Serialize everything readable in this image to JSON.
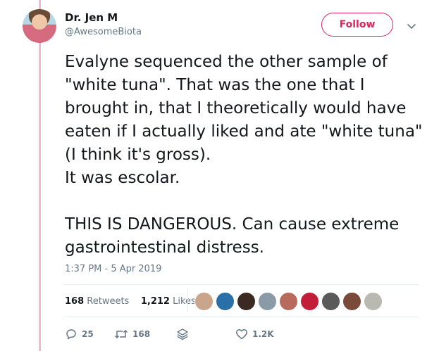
{
  "author": {
    "name": "Dr. Jen M",
    "handle": "@AwesomeBiota"
  },
  "follow_label": "Follow",
  "tweet_text": "Evalyne sequenced the other sample of \"white tuna\". That was the one that I brought in, that I theoretically would have eaten if I actually liked and ate \"white tuna\" (I think it's gross).\nIt was escolar.\n\nTHIS IS DANGEROUS. Can cause extreme gastrointestinal distress.",
  "timestamp": "1:37 PM - 5 Apr 2019",
  "stats": {
    "retweets_count": "168",
    "retweets_label": "Retweets",
    "likes_count": "1,212",
    "likes_label": "Likes"
  },
  "actions": {
    "reply_count": "25",
    "retweet_count": "168",
    "like_count": "1.2K"
  },
  "colors": {
    "accent": "#e0245e",
    "thread_line": "#f1b9d4",
    "secondary_text": "#657786"
  },
  "likers": [
    {
      "color": "#c9a58b"
    },
    {
      "color": "#2a6fa8"
    },
    {
      "color": "#3a2a22"
    },
    {
      "color": "#8a9aa6"
    },
    {
      "color": "#b86a5c"
    },
    {
      "color": "#c21e3a"
    },
    {
      "color": "#5a5a5a"
    },
    {
      "color": "#7a4a3a"
    },
    {
      "color": "#b9b9b2"
    }
  ]
}
